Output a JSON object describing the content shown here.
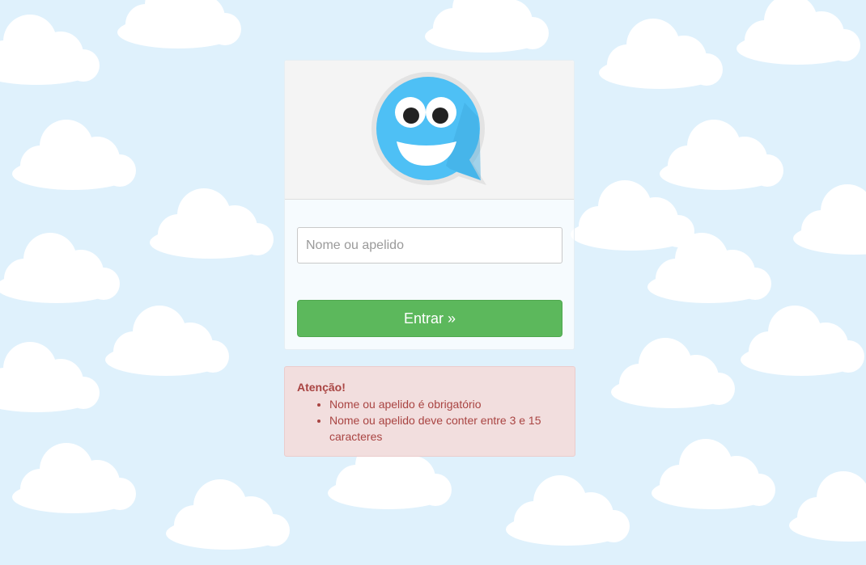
{
  "login": {
    "name_placeholder": "Nome ou apelido",
    "submit_label": "Entrar »"
  },
  "alert": {
    "title": "Atenção!",
    "errors": [
      "Nome ou apelido é obrigatório",
      "Nome ou apelido deve conter entre 3 e 15 caracteres"
    ]
  },
  "icons": {
    "logo": "smiling-chat-bubble-icon"
  },
  "colors": {
    "sky": "#dff1fc",
    "cloud": "#ffffff",
    "logo_blue": "#4ec0f5",
    "button_green": "#5cb85c",
    "alert_bg": "#f2dede",
    "alert_text": "#a94442"
  }
}
